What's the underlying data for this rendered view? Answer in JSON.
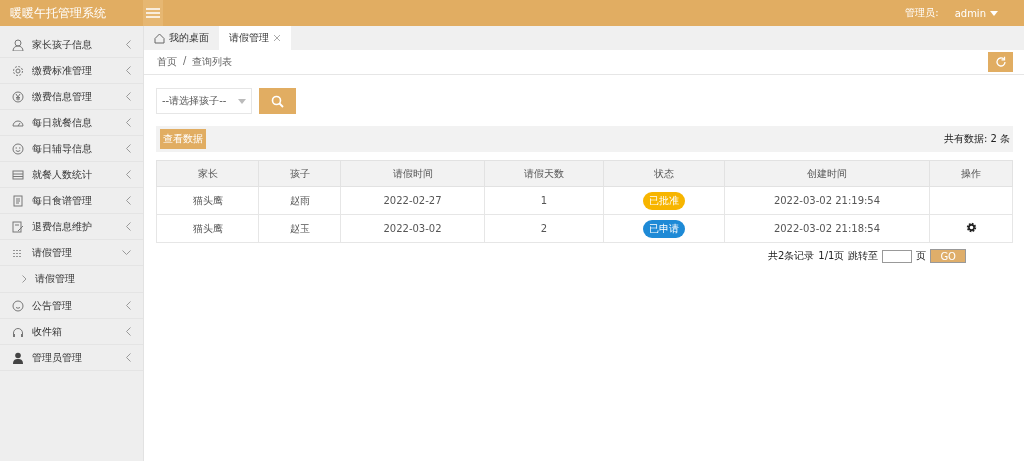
{
  "header": {
    "title": "暖暖午托管理系统",
    "user_label": "管理员:",
    "user_name": "admin"
  },
  "sidebar": {
    "items": [
      {
        "label": "家长孩子信息",
        "expanded": false
      },
      {
        "label": "缴费标准管理",
        "expanded": false
      },
      {
        "label": "缴费信息管理",
        "expanded": false
      },
      {
        "label": "每日就餐信息",
        "expanded": false
      },
      {
        "label": "每日辅导信息",
        "expanded": false
      },
      {
        "label": "就餐人数统计",
        "expanded": false
      },
      {
        "label": "每日食谱管理",
        "expanded": false
      },
      {
        "label": "退费信息维护",
        "expanded": false
      },
      {
        "label": "请假管理",
        "expanded": true,
        "children": [
          {
            "label": "请假管理"
          }
        ]
      },
      {
        "label": "公告管理",
        "expanded": false
      },
      {
        "label": "收件箱",
        "expanded": false
      },
      {
        "label": "管理员管理",
        "expanded": false
      }
    ]
  },
  "tabs": [
    {
      "label": "我的桌面",
      "selected": false
    },
    {
      "label": "请假管理",
      "selected": true
    }
  ],
  "breadcrumb": [
    "首页",
    "/",
    "查询列表"
  ],
  "search": {
    "placeholder": "--请选择孩子--"
  },
  "toolbar": {
    "button": "查看数据",
    "total": "共有数据: 2 条"
  },
  "table": {
    "columns": [
      "家长",
      "孩子",
      "请假时间",
      "请假天数",
      "状态",
      "创建时间",
      "操作"
    ],
    "rows": [
      {
        "parent": "猫头鹰",
        "child": "赵雨",
        "date": "2022-02-27",
        "days": "1",
        "status": {
          "label": "已批准",
          "kind": "approved"
        },
        "created": "2022-03-02 21:19:54"
      },
      {
        "parent": "猫头鹰",
        "child": "赵玉",
        "date": "2022-03-02",
        "days": "2",
        "status": {
          "label": "已申请",
          "kind": "applied"
        },
        "created": "2022-03-02 21:18:54",
        "action": {
          "kind": "settings"
        }
      }
    ]
  },
  "pagination": {
    "records": "共2条记录",
    "pages": "1/1页",
    "jump_label": "跳转至",
    "page_unit": "页",
    "go": "GO"
  }
}
